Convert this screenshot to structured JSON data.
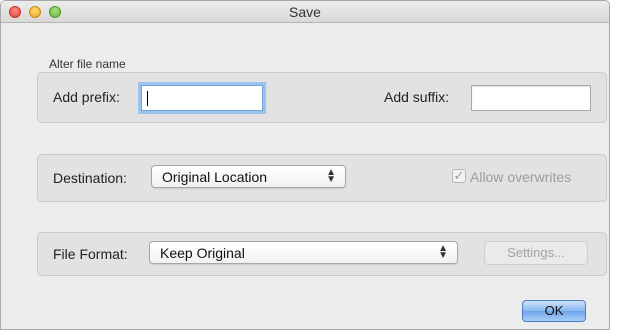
{
  "window": {
    "title": "Save"
  },
  "rename": {
    "group_label": "Alter file name",
    "prefix_label": "Add prefix:",
    "prefix_value": "",
    "suffix_label": "Add suffix:",
    "suffix_value": ""
  },
  "destination": {
    "label": "Destination:",
    "selected": "Original Location",
    "allow_overwrites_label": "Allow overwrites",
    "allow_overwrites_checked": true
  },
  "format": {
    "label": "File Format:",
    "selected": "Keep Original",
    "settings_label": "Settings..."
  },
  "footer": {
    "ok_label": "OK"
  }
}
